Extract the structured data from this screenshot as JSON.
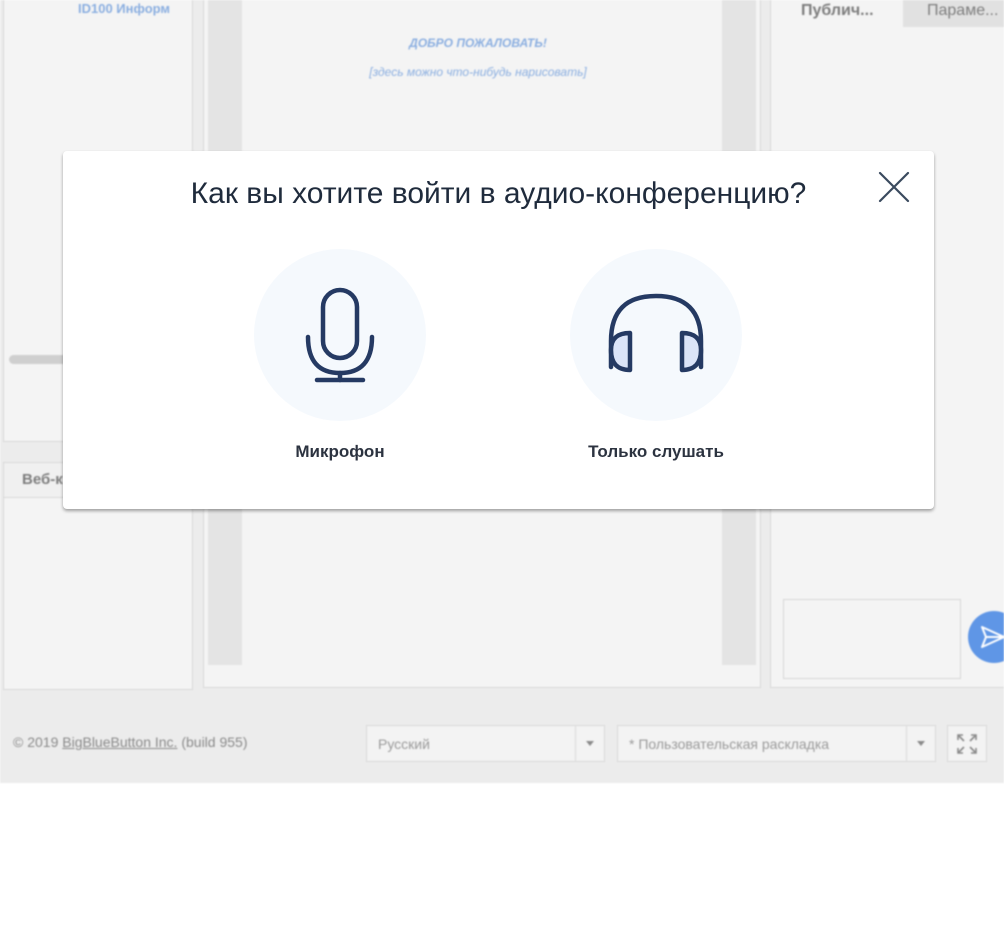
{
  "background_app": {
    "users_panel": {
      "title": "ID100 Информ"
    },
    "webcam_panel": {
      "tab_label": "Веб-к"
    },
    "presentation": {
      "welcome_title": "ДОБРО ПОЖАЛОВАТЬ!",
      "welcome_subtitle": "[здесь можно что-нибудь нарисовать]"
    },
    "chat": {
      "tabs": [
        {
          "label": "Публич..."
        },
        {
          "label": "Параме..."
        }
      ]
    },
    "footer": {
      "copyright_prefix": "© 2019",
      "copyright_link": "BigBlueButton Inc.",
      "build": "(build 955)",
      "language_select": {
        "value": "Русский"
      },
      "layout_select": {
        "value": "* Пользовательская раскладка"
      }
    }
  },
  "audio_modal": {
    "title": "Как вы хотите войти в аудио-конференцию?",
    "options": [
      {
        "label": "Микрофон",
        "icon": "microphone-icon"
      },
      {
        "label": "Только слушать",
        "icon": "headphones-icon"
      }
    ]
  },
  "colors": {
    "modal_title": "#1f2b3c",
    "icon_stroke": "#253a63",
    "headphone_fill": "#dbe4f8",
    "option_circle": "#f5f9fd",
    "send_button": "#5f96e6",
    "welcome_text": "#8aaee0"
  }
}
